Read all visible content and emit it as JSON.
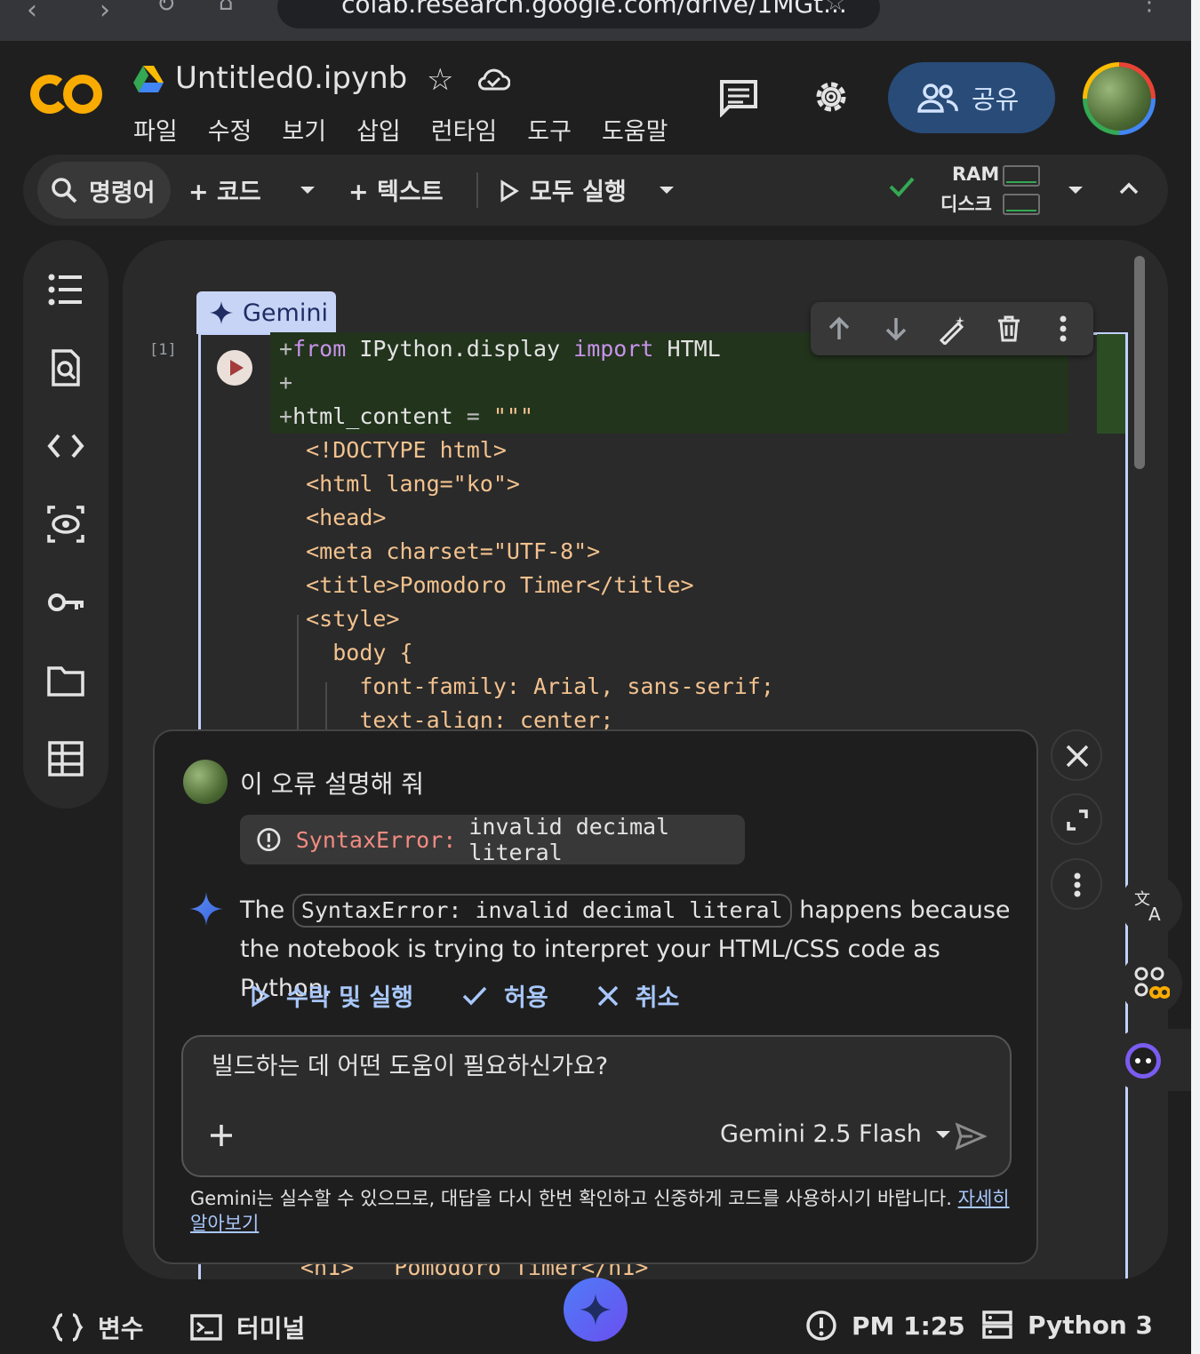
{
  "browser": {
    "url": "colab.research.google.com/drive/1MGt..."
  },
  "header": {
    "logo": "CO",
    "title": "Untitled0.ipynb",
    "menu": [
      "파일",
      "수정",
      "보기",
      "삽입",
      "런타임",
      "도구",
      "도움말"
    ],
    "share_label": "공유"
  },
  "toolbar": {
    "command_label": "명령어",
    "code_label": "+ 코드",
    "text_label": "+ 텍스트",
    "run_all_label": "모두 실행",
    "ram_label": "RAM",
    "disk_label": "디스크"
  },
  "cell": {
    "tab_label": "Gemini",
    "exec_count": "[1]",
    "code_lines": [
      {
        "prefix": "+",
        "indent": 0,
        "parts": [
          {
            "t": "from ",
            "c": "kw"
          },
          {
            "t": "IPython.display ",
            "c": "nm"
          },
          {
            "t": "import ",
            "c": "kw"
          },
          {
            "t": "HTML",
            "c": "nm"
          }
        ]
      },
      {
        "prefix": "+",
        "indent": 0,
        "parts": []
      },
      {
        "prefix": "+",
        "indent": 0,
        "parts": [
          {
            "t": "html_content ",
            "c": "nm"
          },
          {
            "t": "= ",
            "c": "op"
          },
          {
            "t": "\"\"\"",
            "c": "str"
          }
        ]
      },
      {
        "prefix": " ",
        "indent": 1,
        "parts": [
          {
            "t": "<!DOCTYPE html>",
            "c": "str"
          }
        ]
      },
      {
        "prefix": " ",
        "indent": 1,
        "parts": [
          {
            "t": "<html lang=\"ko\">",
            "c": "str"
          }
        ]
      },
      {
        "prefix": " ",
        "indent": 1,
        "parts": [
          {
            "t": "<head>",
            "c": "str"
          }
        ]
      },
      {
        "prefix": " ",
        "indent": 1,
        "parts": [
          {
            "t": "<meta charset=\"UTF-8\">",
            "c": "str"
          }
        ]
      },
      {
        "prefix": " ",
        "indent": 1,
        "parts": [
          {
            "t": "<title>Pomodoro Timer</title>",
            "c": "str"
          }
        ]
      },
      {
        "prefix": " ",
        "indent": 1,
        "parts": [
          {
            "t": "<style>",
            "c": "str"
          }
        ]
      },
      {
        "prefix": " ",
        "indent": 2,
        "parts": [
          {
            "t": "body {",
            "c": "str"
          }
        ]
      },
      {
        "prefix": " ",
        "indent": 3,
        "parts": [
          {
            "t": "font-family: Arial, sans-serif;",
            "c": "str"
          }
        ]
      },
      {
        "prefix": " ",
        "indent": 3,
        "parts": [
          {
            "t": "text-align: center;",
            "c": "str"
          }
        ]
      }
    ],
    "bottom_fragment": "<h1>   Pomodoro Timer</h1>"
  },
  "chat": {
    "user_message": "이 오류 설명해 줘",
    "error_type": "SyntaxError:",
    "error_message": "invalid decimal literal",
    "response_prefix": "The",
    "response_code": "SyntaxError: invalid decimal literal",
    "response_suffix": "happens because the notebook is trying to interpret your HTML/CSS code as Python.",
    "actions": [
      "수락 및 실행",
      "허용",
      "취소"
    ],
    "input_placeholder": "빌드하는 데 어떤 도움이 필요하신가요?",
    "model": "Gemini 2.5 Flash",
    "disclaimer": "Gemini는 실수할 수 있으므로, 대답을 다시 한번 확인하고 신중하게 코드를 사용하시기 바랍니다.",
    "learn_more": "자세히 알아보기"
  },
  "status": {
    "variables_label": "변수",
    "terminal_label": "터미널",
    "time": "PM 1:25",
    "runtime": "Python 3"
  },
  "colors": {
    "accent": "#a8c7fa",
    "share_bg": "#284b78",
    "logo_orange": "#f9ab00",
    "error_red": "#f28b82",
    "ok_green": "#34a853"
  }
}
